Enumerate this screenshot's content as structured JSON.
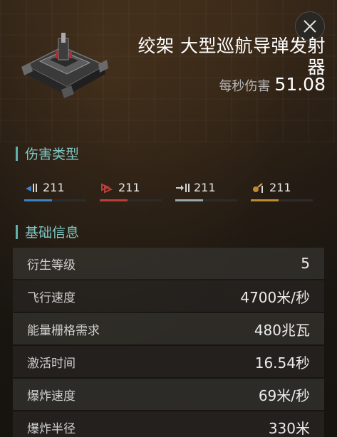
{
  "item": {
    "title": "绞架 大型巡航导弹发射器",
    "dps_label": "每秒伤害",
    "dps_value": "51.08"
  },
  "damage_section": {
    "title": "伤害类型",
    "types": [
      {
        "icon": "em-damage-icon",
        "value": "211",
        "color": "#3d82c4",
        "fill": 0.45
      },
      {
        "icon": "thermal-damage-icon",
        "value": "211",
        "color": "#b8403b",
        "fill": 0.45
      },
      {
        "icon": "kinetic-damage-icon",
        "value": "211",
        "color": "#9aa7ad",
        "fill": 0.45
      },
      {
        "icon": "explosive-damage-icon",
        "value": "211",
        "color": "#c08a34",
        "fill": 0.45
      }
    ]
  },
  "info_section": {
    "title": "基础信息",
    "rows": [
      {
        "name": "衍生等级",
        "value": "5"
      },
      {
        "name": "飞行速度",
        "value": "4700米/秒"
      },
      {
        "name": "能量栅格需求",
        "value": "480兆瓦"
      },
      {
        "name": "激活时间",
        "value": "16.54秒"
      },
      {
        "name": "爆炸速度",
        "value": "69米/秒"
      },
      {
        "name": "爆炸半径",
        "value": "330米"
      }
    ]
  },
  "colors": {
    "accent": "#7fc6c4",
    "background": "#16140f"
  }
}
